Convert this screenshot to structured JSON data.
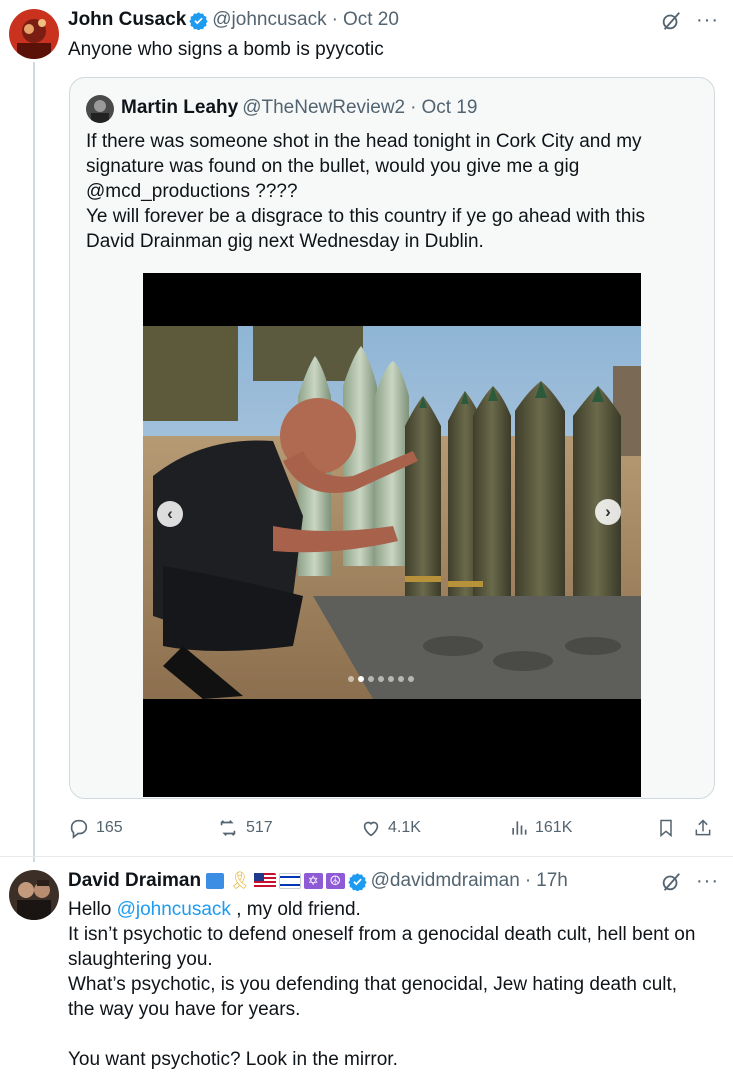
{
  "tweet1": {
    "name": "John Cusack",
    "handle": "@johncusack",
    "date": "Oct 20",
    "text": "Anyone who signs a bomb is pyycotic"
  },
  "quote": {
    "name": "Martin Leahy",
    "handle": "@TheNewReview2",
    "date": "Oct 19",
    "line1": "If there was someone shot in the head tonight in Cork City and my",
    "line2": "signature was found on the bullet, would you give me a gig",
    "line3": "@mcd_productions ????",
    "line4": "Ye will forever be a disgrace to this country if ye go ahead with this",
    "line5": "David Drainman gig next Wednesday in Dublin."
  },
  "media": {
    "prev_icon": "chevron-left-icon",
    "next_icon": "chevron-right-icon",
    "dots_count": 7,
    "active_dot": 1
  },
  "actions": {
    "replies": "165",
    "reposts": "517",
    "likes": "4.1K",
    "views": "161K"
  },
  "tweet2": {
    "name": "David Draiman",
    "handle": "@davidmdraiman",
    "time": "17h",
    "greeting_pre": "Hello ",
    "greeting_mention": "@johncusack",
    "greeting_post": " , my old friend.",
    "line2": "It isn’t psychotic to defend oneself from a genocidal death cult, hell bent on",
    "line3": "slaughtering you.",
    "line4": "What’s psychotic, is you defending that genocidal, Jew hating death cult,",
    "line5": "the way you have for years.",
    "line6": "You want psychotic? Look in the mirror."
  },
  "colors": {
    "accent": "#1d9bf0",
    "muted": "#536471",
    "border": "#cfd9de"
  }
}
